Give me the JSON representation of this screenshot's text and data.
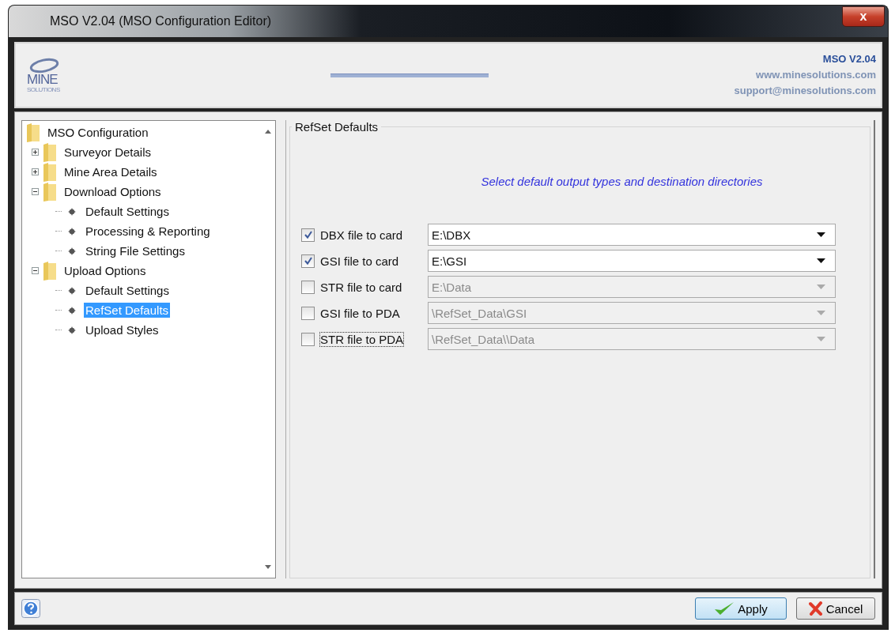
{
  "window": {
    "title": "MSO V2.04  (MSO Configuration Editor)",
    "close": "x"
  },
  "header": {
    "logo_text": "MINE",
    "logo_subtext": "SOLUTIONS",
    "version": "MSO V2.04",
    "website": "www.minesolutions.com",
    "email": "support@minesolutions.com"
  },
  "tree": {
    "label": "MSO Configuration",
    "kind": "folder",
    "selected": false,
    "children": [
      {
        "label": "Surveyor Details",
        "kind": "folder",
        "expanded": false,
        "selected": false
      },
      {
        "label": "Mine Area Details",
        "kind": "folder",
        "expanded": false,
        "selected": false
      },
      {
        "label": "Download Options",
        "kind": "folder",
        "expanded": true,
        "selected": false,
        "children": [
          {
            "label": "Default Settings",
            "kind": "leaf",
            "selected": false
          },
          {
            "label": "Processing & Reporting",
            "kind": "leaf",
            "selected": false
          },
          {
            "label": "String File Settings",
            "kind": "leaf",
            "selected": false
          }
        ]
      },
      {
        "label": "Upload Options",
        "kind": "folder",
        "expanded": true,
        "selected": false,
        "children": [
          {
            "label": "Default Settings",
            "kind": "leaf",
            "selected": false
          },
          {
            "label": "RefSet Defaults",
            "kind": "leaf",
            "selected": true
          },
          {
            "label": "Upload Styles",
            "kind": "leaf",
            "selected": false
          }
        ]
      }
    ]
  },
  "panel": {
    "title": "RefSet Defaults",
    "instruction": "Select default output types and destination directories",
    "rows": [
      {
        "label": "DBX file to card",
        "checked": true,
        "focused": false,
        "path": "E:\\DBX"
      },
      {
        "label": "GSI file to card",
        "checked": true,
        "focused": false,
        "path": "E:\\GSI"
      },
      {
        "label": "STR file to card",
        "checked": false,
        "focused": false,
        "path": "E:\\Data"
      },
      {
        "label": "GSI file to PDA",
        "checked": false,
        "focused": false,
        "path": "\\RefSet_Data\\GSI"
      },
      {
        "label": "STR file to PDA",
        "checked": false,
        "focused": true,
        "path": "\\RefSet_Data\\\\Data"
      }
    ]
  },
  "buttons": [
    {
      "kind": "apply",
      "label": "Apply"
    },
    {
      "kind": "cancel",
      "label": "Cancel"
    }
  ]
}
